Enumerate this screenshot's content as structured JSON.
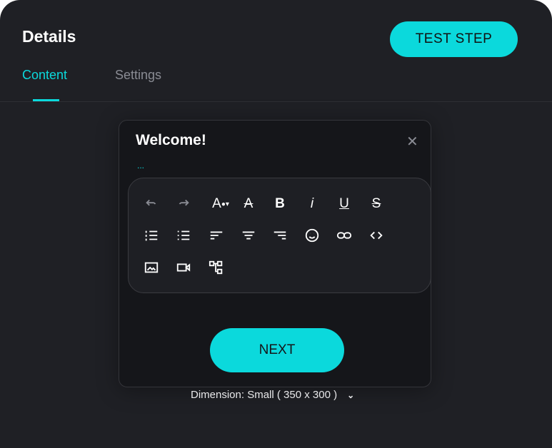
{
  "header": {
    "title": "Details",
    "test_step_label": "TEST STEP"
  },
  "tabs": [
    {
      "label": "Content",
      "active": true
    },
    {
      "label": "Settings",
      "active": false
    }
  ],
  "card": {
    "title": "Welcome!",
    "body_placeholder": "...",
    "next_label": "NEXT",
    "close_icon": "close-icon"
  },
  "toolbar": {
    "rows": [
      [
        "undo",
        "redo",
        "font-color",
        "clear-format",
        "bold",
        "italic",
        "underline",
        "strikethrough"
      ],
      [
        "ordered-list",
        "bullet-list",
        "align-left",
        "align-center",
        "align-right",
        "emoji",
        "link",
        "code"
      ],
      [
        "image",
        "video",
        "tree"
      ]
    ]
  },
  "dimension": {
    "label": "Dimension: Small ( 350 x 300 )"
  },
  "colors": {
    "accent": "#0bd9dc",
    "background": "#1f2025",
    "card": "#15161a"
  }
}
